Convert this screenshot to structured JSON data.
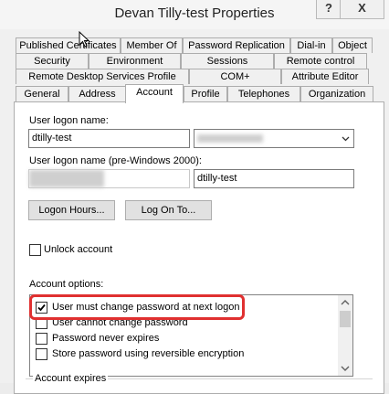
{
  "window": {
    "title": "Devan Tilly-test Properties",
    "help_label": "?",
    "close_label": "X"
  },
  "tabs": {
    "row1": [
      "Published Certificates",
      "Member Of",
      "Password Replication",
      "Dial-in",
      "Object"
    ],
    "row2": [
      "Security",
      "Environment",
      "Sessions",
      "Remote control"
    ],
    "row3": [
      "Remote Desktop Services Profile",
      "COM+",
      "Attribute Editor"
    ],
    "row4": [
      "General",
      "Address",
      "Account",
      "Profile",
      "Telephones",
      "Organization"
    ],
    "active": "Account"
  },
  "account": {
    "logon_name_label": "User logon name:",
    "logon_name_value": "dtilly-test",
    "domain_value": "",
    "pre2000_label": "User logon name (pre-Windows 2000):",
    "pre2000_value": "dtilly-test",
    "logon_hours_button": "Logon Hours...",
    "log_on_to_button": "Log On To...",
    "unlock_label": "Unlock account",
    "options_label": "Account options:",
    "options": [
      {
        "label": "User must change password at next logon",
        "checked": true
      },
      {
        "label": "User cannot change password",
        "checked": false
      },
      {
        "label": "Password never expires",
        "checked": false
      },
      {
        "label": "Store password using reversible encryption",
        "checked": false
      }
    ],
    "expires_label": "Account expires"
  },
  "colors": {
    "highlight": "#e03030",
    "panel": "#ffffff",
    "window": "#f0f0f0"
  }
}
